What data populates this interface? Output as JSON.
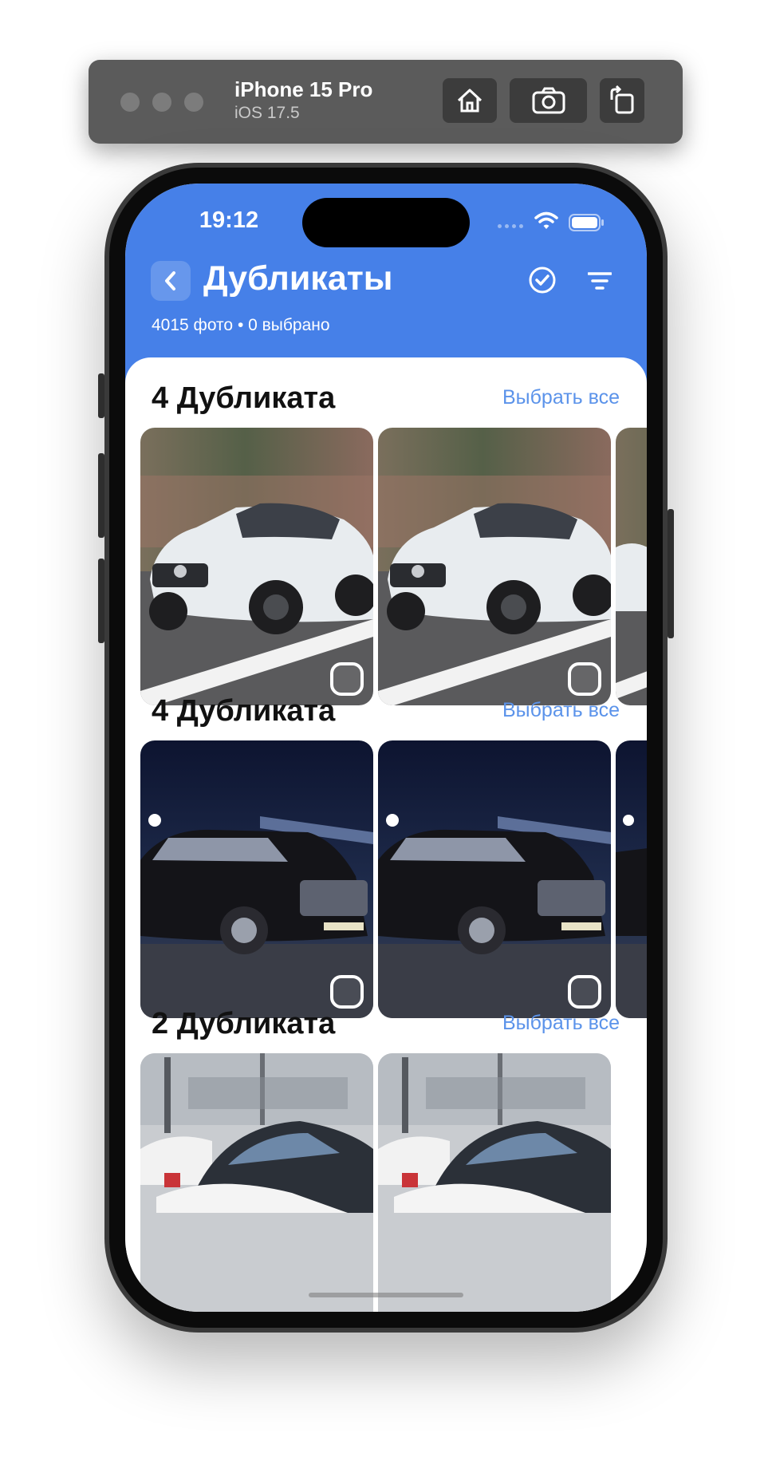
{
  "simulator": {
    "device_name": "iPhone 15 Pro",
    "os_version": "iOS 17.5",
    "buttons": [
      "home-icon",
      "screenshot-icon",
      "rotate-icon"
    ]
  },
  "status_bar": {
    "time": "19:12"
  },
  "header": {
    "title": "Дубликаты",
    "subtitle": "4015 фото • 0 выбрано",
    "accent_color": "#4680e8"
  },
  "groups": [
    {
      "title": "4 Дубликата",
      "select_all_label": "Выбрать все",
      "photo_theme": "white-suv-road"
    },
    {
      "title": "4 Дубликата",
      "select_all_label": "Выбрать все",
      "photo_theme": "black-suv-night"
    },
    {
      "title": "2 Дубликата",
      "select_all_label": "Выбрать все",
      "photo_theme": "parking-lot-cars"
    }
  ],
  "link_color": "#5b93ea"
}
